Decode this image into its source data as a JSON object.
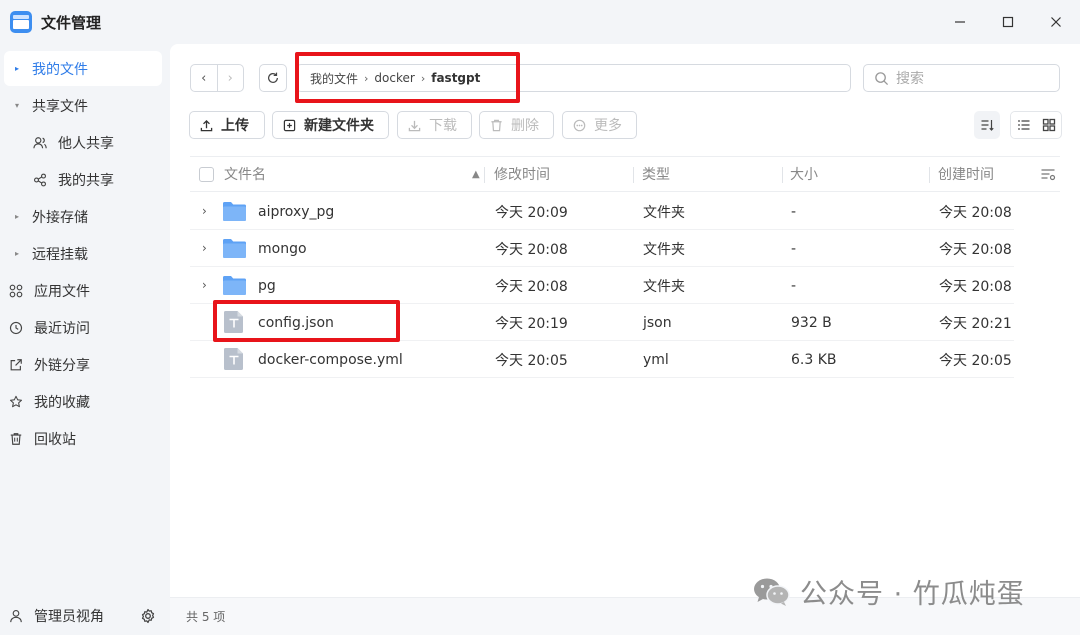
{
  "app": {
    "title": "文件管理"
  },
  "sidebar": {
    "items": [
      {
        "label": "我的文件",
        "icon": "caret-right-icon"
      },
      {
        "label": "共享文件",
        "icon": "caret-down-icon"
      },
      {
        "label": "他人共享",
        "icon": "users-icon"
      },
      {
        "label": "我的共享",
        "icon": "share-icon"
      },
      {
        "label": "外接存储",
        "icon": "caret-right-icon"
      },
      {
        "label": "远程挂载",
        "icon": "caret-right-icon"
      },
      {
        "label": "应用文件",
        "icon": "apps-icon"
      },
      {
        "label": "最近访问",
        "icon": "clock-icon"
      },
      {
        "label": "外链分享",
        "icon": "external-link-icon"
      },
      {
        "label": "我的收藏",
        "icon": "star-icon"
      },
      {
        "label": "回收站",
        "icon": "trash-icon"
      }
    ],
    "active_index": 0,
    "bottom": {
      "label": "管理员视角"
    }
  },
  "pathbar": {
    "crumbs": [
      "我的文件",
      "docker",
      "fastgpt"
    ]
  },
  "search": {
    "placeholder": "搜索"
  },
  "toolbar": {
    "upload": "上传",
    "new_folder": "新建文件夹",
    "download": "下载",
    "delete": "删除",
    "more": "更多"
  },
  "table": {
    "columns": [
      "文件名",
      "修改时间",
      "类型",
      "大小",
      "创建时间"
    ],
    "rows": [
      {
        "name": "aiproxy_pg",
        "modified": "今天 20:09",
        "type": "文件夹",
        "size": "-",
        "created": "今天 20:08",
        "kind": "folder"
      },
      {
        "name": "mongo",
        "modified": "今天 20:08",
        "type": "文件夹",
        "size": "-",
        "created": "今天 20:08",
        "kind": "folder"
      },
      {
        "name": "pg",
        "modified": "今天 20:08",
        "type": "文件夹",
        "size": "-",
        "created": "今天 20:08",
        "kind": "folder"
      },
      {
        "name": "config.json",
        "modified": "今天 20:19",
        "type": "json",
        "size": "932 B",
        "created": "今天 20:21",
        "kind": "file"
      },
      {
        "name": "docker-compose.yml",
        "modified": "今天 20:05",
        "type": "yml",
        "size": "6.3 KB",
        "created": "今天 20:05",
        "kind": "file"
      }
    ]
  },
  "footer": {
    "count": "共 5 项"
  },
  "watermark": {
    "text": "公众号 · 竹瓜炖蛋"
  },
  "colors": {
    "accent": "#2f7ce8",
    "folder": "#5ea2f5",
    "highlight": "#e8141a"
  }
}
